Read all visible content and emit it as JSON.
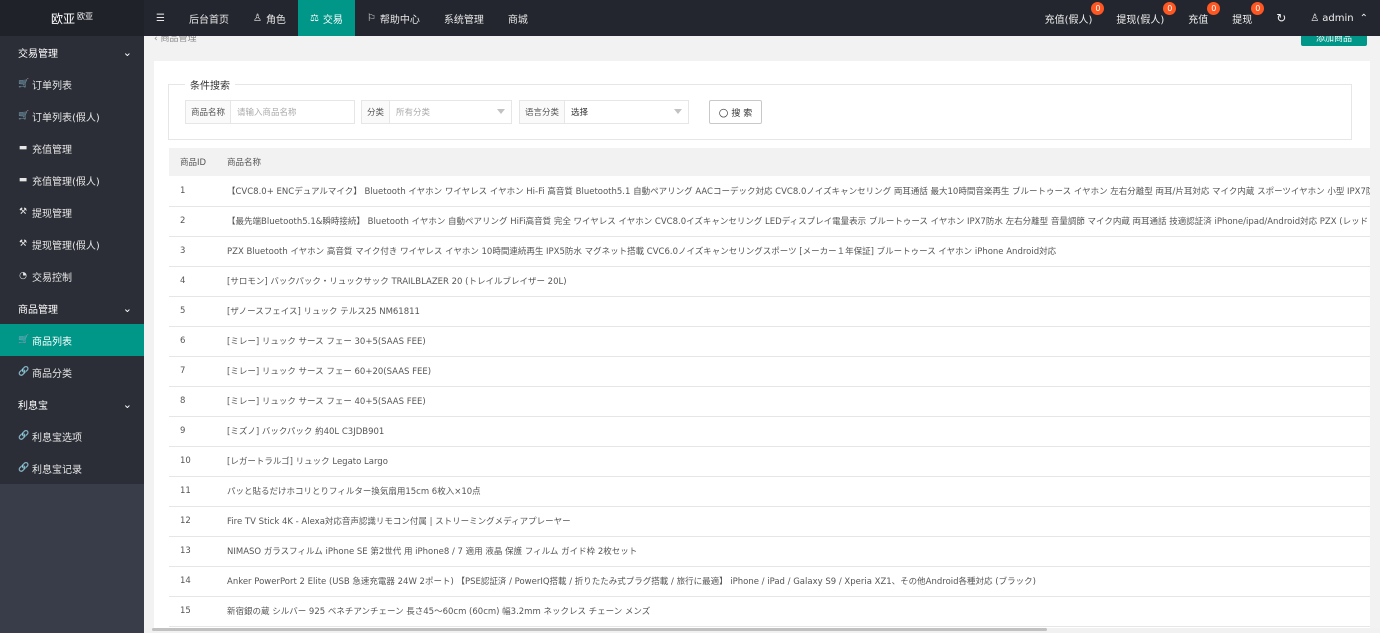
{
  "brand": {
    "name": "欧亚",
    "sup": "欧亚"
  },
  "topnav": [
    {
      "icon": "menu-icon",
      "glyph": "☰",
      "label": ""
    },
    {
      "icon": "",
      "glyph": "",
      "label": "后台首页"
    },
    {
      "icon": "user-icon",
      "glyph": "♙",
      "label": "角色"
    },
    {
      "icon": "scale-icon",
      "glyph": "⚖",
      "label": "交易",
      "active": true
    },
    {
      "icon": "flag-icon",
      "glyph": "⚐",
      "label": "帮助中心"
    },
    {
      "icon": "",
      "glyph": "",
      "label": "系统管理"
    },
    {
      "icon": "",
      "glyph": "",
      "label": "商城"
    }
  ],
  "right_nav": [
    {
      "label": "充值(假人)",
      "badge": "0"
    },
    {
      "label": "提现(假人)",
      "badge": "0"
    },
    {
      "label": "充值",
      "badge": "0"
    },
    {
      "label": "提现",
      "badge": "0"
    }
  ],
  "user": {
    "name": "admin"
  },
  "sidebar": [
    {
      "type": "group",
      "label": "交易管理"
    },
    {
      "type": "item",
      "icon": "cart-icon",
      "glyph": "🛒",
      "label": "订单列表"
    },
    {
      "type": "item",
      "icon": "cart-icon",
      "glyph": "🛒",
      "label": "订单列表(假人)"
    },
    {
      "type": "item",
      "icon": "card-icon",
      "glyph": "▬",
      "label": "充值管理"
    },
    {
      "type": "item",
      "icon": "card-icon",
      "glyph": "▬",
      "label": "充值管理(假人)"
    },
    {
      "type": "item",
      "icon": "hammer-icon",
      "glyph": "⚒",
      "label": "提现管理"
    },
    {
      "type": "item",
      "icon": "hammer-icon",
      "glyph": "⚒",
      "label": "提现管理(假人)"
    },
    {
      "type": "item",
      "icon": "gauge-icon",
      "glyph": "◔",
      "label": "交易控制"
    },
    {
      "type": "group",
      "label": "商品管理"
    },
    {
      "type": "item",
      "icon": "cart-icon",
      "glyph": "🛒",
      "label": "商品列表",
      "active": true
    },
    {
      "type": "item",
      "icon": "link-icon",
      "glyph": "🔗",
      "label": "商品分类"
    },
    {
      "type": "group",
      "label": "利息宝"
    },
    {
      "type": "item",
      "icon": "link-icon",
      "glyph": "🔗",
      "label": "利息宝选项"
    },
    {
      "type": "item",
      "icon": "link-icon",
      "glyph": "🔗",
      "label": "利息宝记录"
    }
  ],
  "search": {
    "legend": "条件搜索",
    "name_label": "商品名称",
    "name_placeholder": "请输入商品名称",
    "category_label": "分类",
    "category_value": "所有分类",
    "lang_label": "语言分类",
    "lang_value": "选择",
    "button": "搜 索"
  },
  "table": {
    "columns": [
      "商品ID",
      "商品名称"
    ],
    "rows": [
      [
        "1",
        "【CVC8.0+ ENCデュアルマイク】 Bluetooth イヤホン ワイヤレス イヤホン Hi-Fi 高音質 Bluetooth5.1 自動ペアリング AACコーデック対応 CVC8.0ノイズキャンセリング 両耳通話 最大10時間音楽再生 ブルートゥース イヤホン 左右分離型 両耳/片耳対応 マイク内蔵 スポーツイヤホン 小型 IPX7防"
      ],
      [
        "2",
        "【最先端Bluetooth5.1&瞬時接続】 Bluetooth イヤホン 自動ペアリング HiFi高音質 完全 ワイヤレス イヤホン CVC8.0イズキャンセリング LEDディスプレイ電量表示 ブルートゥース イヤホン IPX7防水 左右分離型 音量調節 マイク内蔵 両耳通話 技適認証済 iPhone/ipad/Android対応 PZX (レッド"
      ],
      [
        "3",
        "PZX Bluetooth イヤホン 高音質 マイク付き ワイヤレス イヤホン 10時間連続再生 IPX5防水 マグネット搭載 CVC6.0ノイズキャンセリングスポーツ [メーカー１年保証] ブルートゥース イヤホン iPhone Android対応"
      ],
      [
        "4",
        "[サロモン] バックパック・リュックサック TRAILBLAZER 20 (トレイルブレイザー 20L)"
      ],
      [
        "5",
        "[ザノースフェイス] リュック テルス25 NM61811"
      ],
      [
        "6",
        "[ミレー] リュック サース フェー 30+5(SAAS FEE)"
      ],
      [
        "7",
        "[ミレー] リュック サース フェー 60+20(SAAS FEE)"
      ],
      [
        "8",
        "[ミレー] リュック サース フェー 40+5(SAAS FEE)"
      ],
      [
        "9",
        "[ミズノ] バックパック 約40L C3JDB901"
      ],
      [
        "10",
        "[レガートラルゴ] リュック Legato Largo"
      ],
      [
        "11",
        "パッと貼るだけホコリとりフィルター換気扇用15cm 6枚入×10点"
      ],
      [
        "12",
        "Fire TV Stick 4K - Alexa対応音声認識リモコン付属 | ストリーミングメディアプレーヤー"
      ],
      [
        "13",
        "NIMASO ガラスフィルム iPhone SE 第2世代 用 iPhone8 / 7 適用 液晶 保護 フィルム ガイド枠 2枚セット"
      ],
      [
        "14",
        "Anker PowerPort 2 Elite (USB 急速充電器 24W 2ポート) 【PSE認証済 / PowerIQ搭載 / 折りたたみ式プラグ搭載 / 旅行に最適】 iPhone / iPad / Galaxy S9 / Xperia XZ1、その他Android各種対応 (ブラック)"
      ],
      [
        "15",
        "新宿銀の蔵 シルバー 925 ベネチアンチェーン 長さ45～60cm (60cm) 幅3.2mm ネックレス チェーン メンズ"
      ]
    ]
  }
}
